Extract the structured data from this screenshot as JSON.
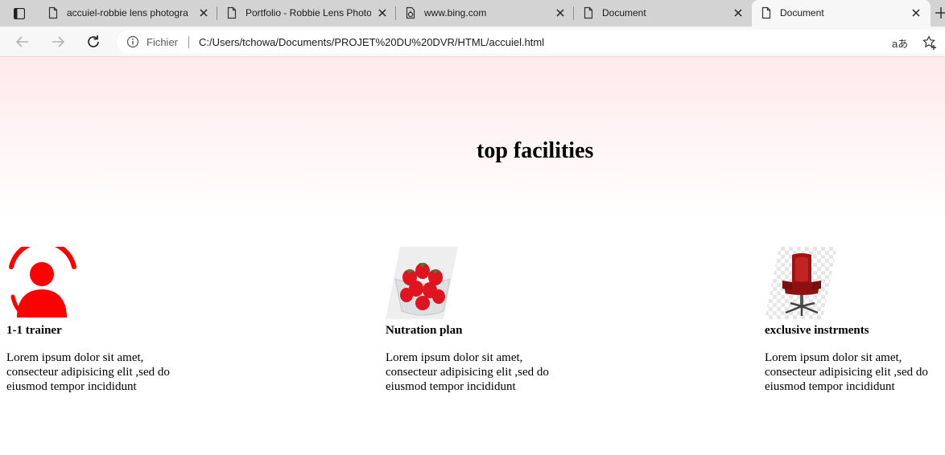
{
  "browser": {
    "tabs": [
      {
        "title": "accuiel-robbie lens photogra"
      },
      {
        "title": "Portfolio - Robbie Lens Photo"
      },
      {
        "title": "www.bing.com"
      },
      {
        "title": "Document"
      },
      {
        "title": "Document",
        "active": true
      }
    ],
    "address": {
      "site_label": "Fichier",
      "url": "C:/Users/tchowa/Documents/PROJET%20DU%20DVR/HTML/accuiel.html"
    },
    "read_aloud_label": "aあ"
  },
  "page": {
    "title": "top facilities",
    "facilities": [
      {
        "icon": "trainer-icon",
        "title": "1-1 trainer",
        "text": "Lorem ipsum dolor sit amet, consecteur adipisicing elit ,sed do eiusmod tempor incididunt"
      },
      {
        "icon": "strawberries-image",
        "title": "Nutration plan",
        "text": "Lorem ipsum dolor sit amet, consecteur adipisicing elit ,sed do eiusmod tempor incididunt"
      },
      {
        "icon": "office-chair-image",
        "title": "exclusive instrments",
        "text": "Lorem ipsum dolor sit amet, consecteur adipisicing elit ,sed do eiusmod tempor incididunt"
      }
    ],
    "colors": {
      "accent": "#ff0000",
      "gradient_top": "#ffe9ec"
    }
  }
}
